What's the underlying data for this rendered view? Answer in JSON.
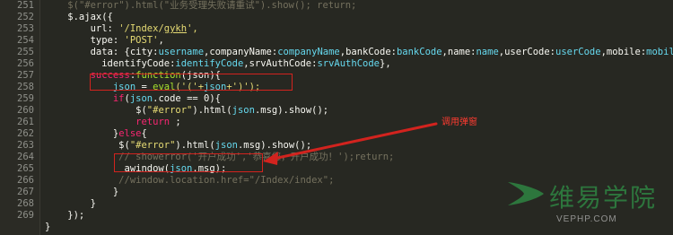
{
  "gutter": {
    "numbers": [
      "251",
      "252",
      "253",
      "254",
      "255",
      "256",
      "257",
      "258",
      "259",
      "260",
      "261",
      "262",
      "263",
      "264",
      "265",
      "266",
      "267",
      "268",
      "269"
    ]
  },
  "lines": [
    {
      "tokens": [
        {
          "t": "    ",
          "c": "p"
        },
        {
          "t": "$(\"#error\").html(\"业务受理失败请重试\").show(); return;",
          "c": "c"
        }
      ]
    },
    {
      "tokens": [
        {
          "t": "    $.ajax({",
          "c": "p"
        }
      ]
    },
    {
      "tokens": [
        {
          "t": "        url: ",
          "c": "p"
        },
        {
          "t": "'/Index/",
          "c": "s"
        },
        {
          "t": "gykh",
          "c": "s u"
        },
        {
          "t": "',",
          "c": "s"
        }
      ]
    },
    {
      "tokens": [
        {
          "t": "        type: ",
          "c": "p"
        },
        {
          "t": "'POST'",
          "c": "s"
        },
        {
          "t": ",",
          "c": "p"
        }
      ]
    },
    {
      "tokens": [
        {
          "t": "        data: {city:",
          "c": "p"
        },
        {
          "t": "username",
          "c": "v"
        },
        {
          "t": ",companyName:",
          "c": "p"
        },
        {
          "t": "companyName",
          "c": "v"
        },
        {
          "t": ",bankCode:",
          "c": "p"
        },
        {
          "t": "bankCode",
          "c": "v"
        },
        {
          "t": ",name:",
          "c": "p"
        },
        {
          "t": "name",
          "c": "v"
        },
        {
          "t": ",userCode:",
          "c": "p"
        },
        {
          "t": "userCode",
          "c": "v"
        },
        {
          "t": ",mobile:",
          "c": "p"
        },
        {
          "t": "mobile",
          "c": "v"
        },
        {
          "t": ",",
          "c": "p"
        }
      ]
    },
    {
      "tokens": [
        {
          "t": "          identifyCode:",
          "c": "p"
        },
        {
          "t": "identifyCode",
          "c": "v"
        },
        {
          "t": ",srvAuthCode:",
          "c": "p"
        },
        {
          "t": "srvAuthCode",
          "c": "v"
        },
        {
          "t": "},",
          "c": "p"
        }
      ]
    },
    {
      "tokens": [
        {
          "t": "        ",
          "c": "p"
        },
        {
          "t": "success",
          "c": "k"
        },
        {
          "t": ":",
          "c": "p"
        },
        {
          "t": "function",
          "c": "f"
        },
        {
          "t": "(json){",
          "c": "p"
        }
      ]
    },
    {
      "tokens": [
        {
          "t": "            ",
          "c": "p"
        },
        {
          "t": "json",
          "c": "v"
        },
        {
          "t": " = ",
          "c": "p"
        },
        {
          "t": "eval",
          "c": "f"
        },
        {
          "t": "('('+",
          "c": "s"
        },
        {
          "t": "json",
          "c": "v"
        },
        {
          "t": "+')');",
          "c": "s"
        }
      ]
    },
    {
      "tokens": [
        {
          "t": "            ",
          "c": "p"
        },
        {
          "t": "if",
          "c": "k"
        },
        {
          "t": "(",
          "c": "p"
        },
        {
          "t": "json",
          "c": "v"
        },
        {
          "t": ".code == 0){",
          "c": "p"
        }
      ]
    },
    {
      "tokens": [
        {
          "t": "                $(",
          "c": "p"
        },
        {
          "t": "\"#error\"",
          "c": "s"
        },
        {
          "t": ").html(",
          "c": "p"
        },
        {
          "t": "json",
          "c": "v"
        },
        {
          "t": ".msg).show();",
          "c": "p"
        }
      ]
    },
    {
      "tokens": [
        {
          "t": "                ",
          "c": "p"
        },
        {
          "t": "return",
          "c": "k"
        },
        {
          "t": " ;",
          "c": "p"
        }
      ]
    },
    {
      "tokens": [
        {
          "t": "            }",
          "c": "p"
        },
        {
          "t": "else",
          "c": "k"
        },
        {
          "t": "{",
          "c": "p"
        }
      ]
    },
    {
      "tokens": [
        {
          "t": "             $(",
          "c": "p"
        },
        {
          "t": "\"#error\"",
          "c": "s"
        },
        {
          "t": ").html(",
          "c": "p"
        },
        {
          "t": "json",
          "c": "v"
        },
        {
          "t": ".msg).show();",
          "c": "p"
        }
      ]
    },
    {
      "tokens": [
        {
          "t": "             // showerror('开户成功','恭喜您，开户成功！');return;",
          "c": "c"
        }
      ]
    },
    {
      "tokens": [
        {
          "t": "              awindow(",
          "c": "p"
        },
        {
          "t": "json",
          "c": "v"
        },
        {
          "t": ".msg);",
          "c": "p"
        }
      ]
    },
    {
      "tokens": [
        {
          "t": "             //window.location.href=\"/Index/index\";",
          "c": "c"
        }
      ]
    },
    {
      "tokens": [
        {
          "t": "            }",
          "c": "p"
        }
      ]
    },
    {
      "tokens": [
        {
          "t": "        }",
          "c": "p"
        }
      ]
    },
    {
      "tokens": [
        {
          "t": "    });",
          "c": "p"
        }
      ]
    },
    {
      "tokens": [
        {
          "t": "}",
          "c": "p"
        }
      ]
    }
  ],
  "annotations": {
    "callout": "调用弹窗"
  },
  "watermark": {
    "cn": "维易学院",
    "en": "VEPHP.COM"
  },
  "colors": {
    "annotation": "#d2231e"
  }
}
